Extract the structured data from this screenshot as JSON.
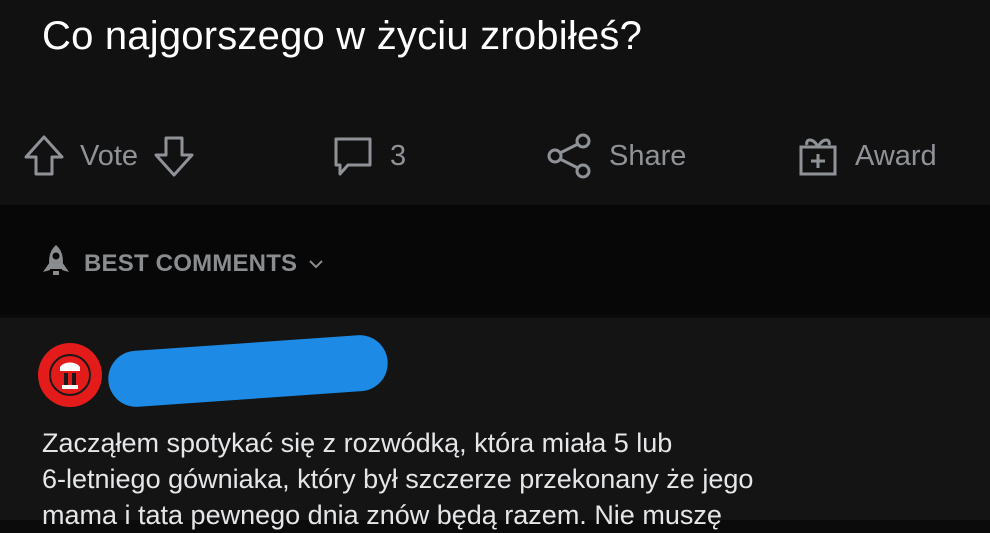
{
  "post": {
    "title": "Co najgorszego w życiu zrobiłeś?"
  },
  "actions": {
    "vote_label": "Vote",
    "comment_count": "3",
    "share_label": "Share",
    "award_label": "Award"
  },
  "sort": {
    "label": "BEST COMMENTS"
  },
  "comment": {
    "lines": [
      "Zacząłem spotykać się z rozwódką, która miała 5 lub",
      "6-letniego gówniaka, który był szczerze przekonany że jego",
      "mama i tata pewnego dnia znów będą razem. Nie muszę"
    ]
  },
  "colors": {
    "background": "#0b0b0c",
    "muted": "#8f9296",
    "redaction": "#1d8be6",
    "avatar": "#e41b1b"
  }
}
